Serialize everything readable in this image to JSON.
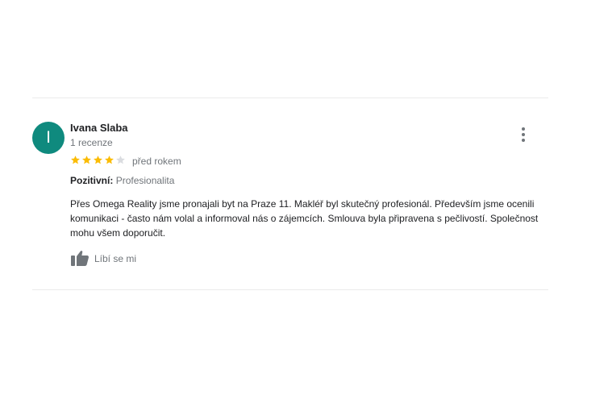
{
  "review": {
    "avatar_letter": "I",
    "avatar_color": "#0f8a7e",
    "author_name": "Ivana Slaba",
    "review_count": "1 recenze",
    "rating": 4,
    "rating_max": 5,
    "star_color": "#fbbc04",
    "star_empty_color": "#dadce0",
    "time": "před rokem",
    "positive_label": "Pozitivní:",
    "positive_value": "Profesionalita",
    "text": "Přes Omega Reality jsme pronajali byt na Praze 11. Makléř byl skutečný profesionál. Především jsme ocenili komunikaci - často nám volal a informoval nás o zájemcích. Smlouva byla připravena s pečlivostí. Společnost mohu všem doporučit.",
    "like_label": "Líbí se mi",
    "more_icon": "more-vert-icon",
    "like_icon": "thumb-up-icon"
  }
}
